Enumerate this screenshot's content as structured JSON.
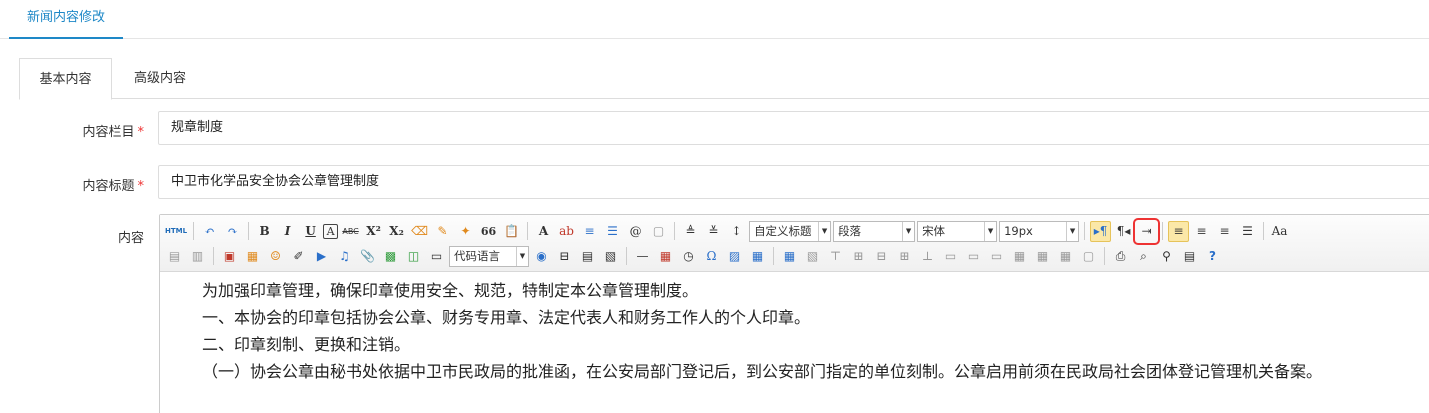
{
  "page_tab": "新闻内容修改",
  "tabs": [
    {
      "label": "基本内容",
      "active": true
    },
    {
      "label": "高级内容",
      "active": false
    }
  ],
  "form": {
    "category_label": "内容栏目",
    "category_value": "规章制度",
    "title_label": "内容标题",
    "title_value": "中卫市化学品安全协会公章管理制度",
    "content_label": "内容",
    "required_mark": "*"
  },
  "toolbar": {
    "html_label": "HTML",
    "bold": "B",
    "italic": "I",
    "underline": "U",
    "strike": "ABC",
    "superscript": "X²",
    "subscript": "X₂",
    "quote": "66",
    "font_color": "A",
    "custom_title": "自定义标题",
    "paragraph": "段落",
    "font_family": "宋体",
    "font_size": "19px",
    "code_language": "代码语言",
    "omega": "Ω",
    "help": "?"
  },
  "colors": {
    "accent": "#1e88c7",
    "required": "#e33333",
    "highlight_box": "#e33333"
  },
  "content": {
    "paragraphs": [
      "为加强印章管理，确保印章使用安全、规范，特制定本公章管理制度。",
      "一、本协会的印章包括协会公章、财务专用章、法定代表人和财务工作人的个人印章。",
      "二、印章刻制、更换和注销。",
      "（一）协会公章由秘书处依据中卫市民政局的批准函，在公安局部门登记后，到公安部门指定的单位刻制。公章启用前须在民政局社会团体登记管理机关备案。"
    ]
  }
}
